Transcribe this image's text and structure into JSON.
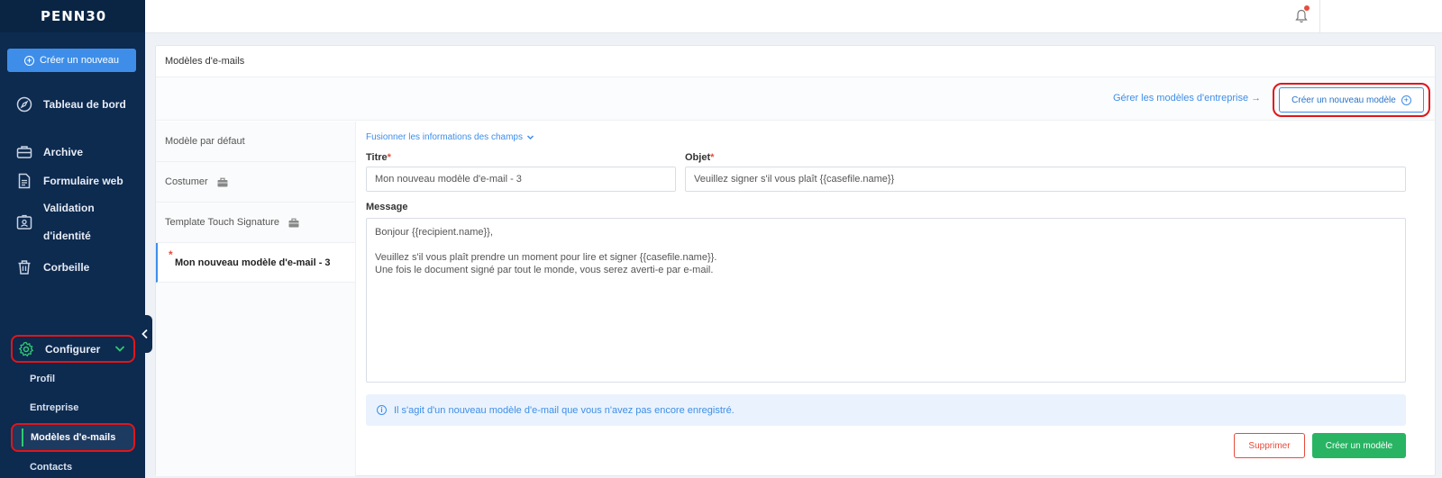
{
  "app": {
    "logo": "PENN30"
  },
  "sidebar": {
    "create_label": "Créer un nouveau",
    "items": [
      {
        "label": "Tableau de bord",
        "icon": "compass-icon"
      },
      {
        "label": "Archive",
        "icon": "briefcase-icon"
      },
      {
        "label": "Formulaire web",
        "icon": "document-icon"
      },
      {
        "label": "Validation",
        "icon": "id-card-icon"
      },
      {
        "label": "d'identité"
      },
      {
        "label": "Corbeille",
        "icon": "trash-icon"
      }
    ],
    "configure": {
      "label": "Configurer",
      "icon": "gear-icon"
    },
    "sub_items": [
      "Profil",
      "Entreprise",
      "Modèles d'e-mails",
      "Contacts"
    ]
  },
  "colors": {
    "sidebar_bg": "#0d2a4f",
    "accent": "#3e8ee9",
    "success": "#28b463",
    "danger": "#e74c3c",
    "highlight": "#e0161a"
  },
  "page": {
    "title": "Modèles d'e-mails",
    "manage_link": "Gérer les modèles d'entreprise",
    "new_model_button": "Créer un nouveau modèle"
  },
  "templates": [
    {
      "label": "Modèle par défaut"
    },
    {
      "label": "Costumer",
      "icon": "briefcase-icon"
    },
    {
      "label": "Template Touch Signature",
      "icon": "briefcase-icon"
    },
    {
      "label": "Mon nouveau modèle d'e-mail - 3",
      "active": true,
      "unsaved": true
    }
  ],
  "form": {
    "merge_link": "Fusionner les informations des champs",
    "title_label": "Titre",
    "title_value": "Mon nouveau modèle d'e-mail - 3",
    "subject_label": "Objet",
    "subject_value": "Veuillez signer s'il vous plaît {{casefile.name}}",
    "message_label": "Message",
    "message_value": "Bonjour {{recipient.name}},\n\nVeuillez s'il vous plaît prendre un moment pour lire et signer {{casefile.name}}.\nUne fois le document signé par tout le monde, vous serez averti-e par e-mail.",
    "info_text": "Il s'agit d'un nouveau modèle d'e-mail que vous n'avez pas encore enregistré.",
    "delete_button": "Supprimer",
    "create_button": "Créer un modèle"
  }
}
